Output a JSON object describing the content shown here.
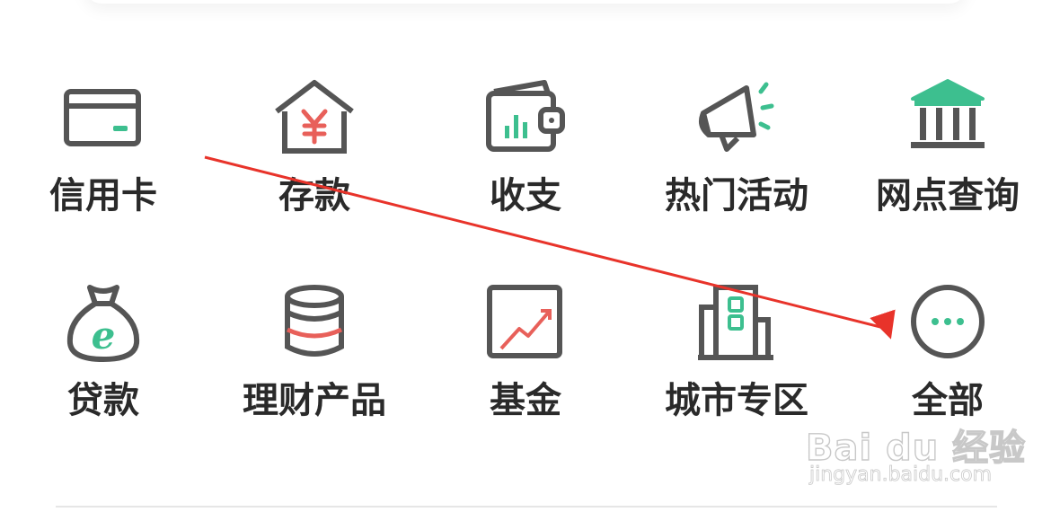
{
  "menu": {
    "row1": [
      {
        "label": "信用卡",
        "icon": "credit-card-icon"
      },
      {
        "label": "存款",
        "icon": "deposit-house-icon"
      },
      {
        "label": "收支",
        "icon": "wallet-chart-icon"
      },
      {
        "label": "热门活动",
        "icon": "megaphone-icon"
      },
      {
        "label": "网点查询",
        "icon": "bank-building-icon"
      }
    ],
    "row2": [
      {
        "label": "贷款",
        "icon": "loan-bag-icon"
      },
      {
        "label": "理财产品",
        "icon": "coin-stack-icon"
      },
      {
        "label": "基金",
        "icon": "fund-trend-icon"
      },
      {
        "label": "城市专区",
        "icon": "city-buildings-icon"
      },
      {
        "label": "全部",
        "icon": "more-dots-icon"
      }
    ]
  },
  "colors": {
    "icon_stroke": "#555555",
    "accent_green": "#3dbf8f",
    "accent_red": "#e8605a",
    "annotation_arrow": "#e8332a"
  },
  "watermark": {
    "logo": "Bai du 经验",
    "url": "jingyan.baidu.com"
  }
}
